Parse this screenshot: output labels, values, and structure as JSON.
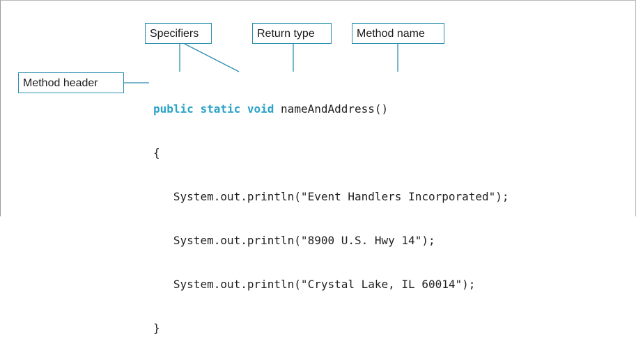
{
  "labels": {
    "specifiers": "Specifiers",
    "return_type": "Return type",
    "method_name": "Method name",
    "method_header": "Method header"
  },
  "code": {
    "header": {
      "kw_public": "public",
      "kw_static": "static",
      "kw_void": "void",
      "name": "nameAndAddress()"
    },
    "open_brace": "{",
    "body_lines": [
      "System.out.println(\"Event Handlers Incorporated\");",
      "System.out.println(\"8900 U.S. Hwy 14\");",
      "System.out.println(\"Crystal Lake, IL 60014\");"
    ],
    "close_brace": "}"
  },
  "colors": {
    "keyword": "#2aa3c9",
    "leader_line": "#2b8fae",
    "callout_border": "#2b8fae",
    "text": "#1f1f1f"
  }
}
